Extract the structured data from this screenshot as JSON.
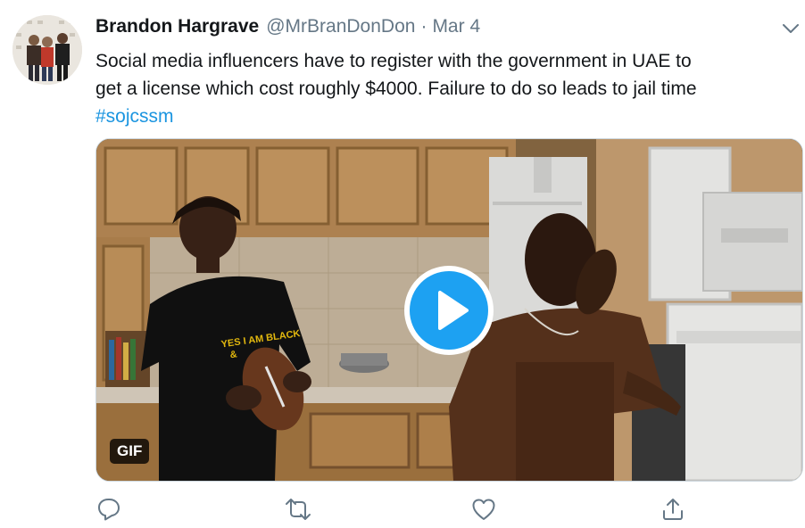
{
  "tweet": {
    "author_name": "Brandon Hargrave",
    "handle": "@MrBranDonDon",
    "separator": "·",
    "date": "Mar 4",
    "text_line_1": "Social media influencers have to register with the government in UAE to",
    "text_line_2": "get a license which cost roughly $4000. Failure to do so leads to jail time",
    "hashtag": "#sojcssm"
  },
  "media": {
    "badge": "GIF",
    "shirt_text_1": "YES I AM BLACK",
    "shirt_text_2": "&"
  },
  "icons": {
    "more": "chevron-down-icon",
    "reply": "reply-icon",
    "retweet": "retweet-icon",
    "like": "heart-icon",
    "share": "share-icon",
    "play": "play-icon"
  },
  "colors": {
    "accent": "#1da1f2",
    "link": "#1b95e0",
    "secondary_text": "#657786",
    "icon": "#657786"
  }
}
